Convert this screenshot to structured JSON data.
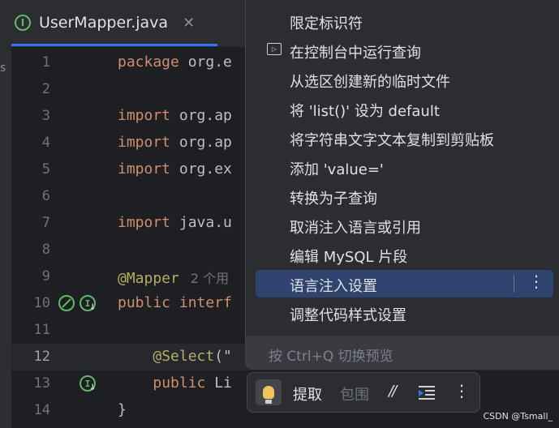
{
  "tab": {
    "title": "UserMapper.java",
    "icon": "interface-icon",
    "close": "✕"
  },
  "left_strip_text": "s",
  "editor": {
    "lines": [
      {
        "num": "1",
        "tokens": [
          [
            "kw",
            "package "
          ],
          [
            "pl",
            "org.e"
          ]
        ]
      },
      {
        "num": "2",
        "tokens": []
      },
      {
        "num": "3",
        "tokens": [
          [
            "kw",
            "import "
          ],
          [
            "pl",
            "org.ap"
          ]
        ]
      },
      {
        "num": "4",
        "tokens": [
          [
            "kw",
            "import "
          ],
          [
            "pl",
            "org.ap"
          ]
        ]
      },
      {
        "num": "5",
        "tokens": [
          [
            "kw",
            "import "
          ],
          [
            "pl",
            "org.ex"
          ]
        ]
      },
      {
        "num": "6",
        "tokens": []
      },
      {
        "num": "7",
        "tokens": [
          [
            "kw",
            "import "
          ],
          [
            "pl",
            "java.u"
          ]
        ]
      },
      {
        "num": "8",
        "tokens": []
      },
      {
        "num": "9",
        "tokens": [
          [
            "ann",
            "@Mapper"
          ]
        ],
        "hint": "2 个用"
      },
      {
        "num": "10",
        "tokens": [
          [
            "kw",
            "public "
          ],
          [
            "kw",
            "interf"
          ]
        ]
      },
      {
        "num": "11",
        "tokens": []
      },
      {
        "num": "12",
        "tokens": [
          [
            "pl",
            "    "
          ],
          [
            "ann",
            "@Select"
          ],
          [
            "pl",
            "(\""
          ]
        ],
        "current": true
      },
      {
        "num": "13",
        "tokens": [
          [
            "pl",
            "    "
          ],
          [
            "kw",
            "public "
          ],
          [
            "pl",
            "Li"
          ]
        ]
      },
      {
        "num": "14",
        "tokens": [
          [
            "pl",
            "}"
          ]
        ]
      }
    ]
  },
  "popup": {
    "items": [
      {
        "label": "限定标识符"
      },
      {
        "label": "在控制台中运行查询",
        "icon": "run-console-icon"
      },
      {
        "label": "从选区创建新的临时文件"
      },
      {
        "label": "将 'list()' 设为 default"
      },
      {
        "label": "将字符串文字文本复制到剪贴板"
      },
      {
        "label": "添加 'value='"
      },
      {
        "label": "转换为子查询"
      },
      {
        "label": "取消注入语言或引用"
      },
      {
        "label": "编辑 MySQL 片段"
      },
      {
        "label": "语言注入设置",
        "selected": true
      },
      {
        "label": "调整代码样式设置"
      }
    ],
    "footer": "按 Ctrl+Q 切换预览",
    "more_glyph": "⋮"
  },
  "toolbar": {
    "extract": "提取",
    "wrap": "包围",
    "comment": "//",
    "more": "⋮"
  },
  "watermark": "CSDN @Tsmall_"
}
